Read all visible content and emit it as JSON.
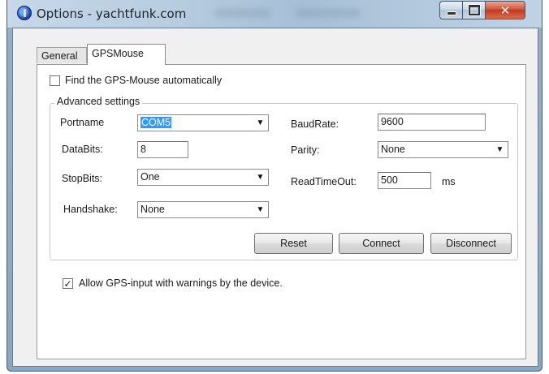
{
  "window": {
    "title": "Options - yachtfunk.com",
    "close_glyph": "✕"
  },
  "tabs": [
    {
      "label": "General"
    },
    {
      "label": "GPSMouse"
    }
  ],
  "auto_find": {
    "label": "Find the GPS-Mouse automatically",
    "checked": false,
    "mark": ""
  },
  "advanced": {
    "legend": "Advanced settings",
    "portname": {
      "label": "Portname",
      "value": "COM5"
    },
    "databits": {
      "label": "DataBits:",
      "value": "8"
    },
    "stopbits": {
      "label": "StopBits:",
      "value": "One"
    },
    "handshake": {
      "label": "Handshake:",
      "value": "None"
    },
    "baudrate": {
      "label": "BaudRate:",
      "value": "9600"
    },
    "parity": {
      "label": "Parity:",
      "value": "None"
    },
    "readtimeout": {
      "label": "ReadTimeOut:",
      "value": "500",
      "unit": "ms"
    },
    "dropdown_arrow": "▼"
  },
  "buttons": {
    "reset": "Reset",
    "connect": "Connect",
    "disconnect": "Disconnect"
  },
  "allow_warnings": {
    "label": "Allow GPS-input with warnings by the device.",
    "checked": true,
    "mark": "✓"
  },
  "colors": {
    "selection": "#3399ff",
    "close_button": "#c03a1f",
    "titlebar": "#b8cde0"
  }
}
